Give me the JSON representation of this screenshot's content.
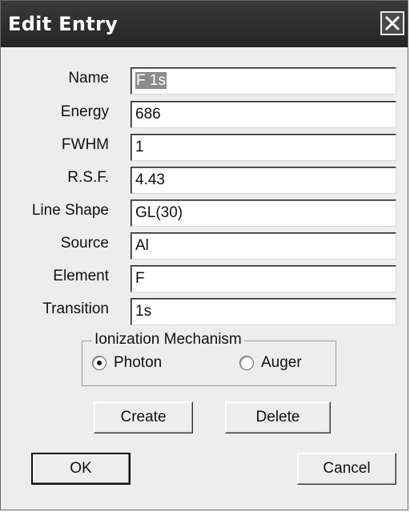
{
  "window": {
    "title": "Edit Entry",
    "close_icon": "close-x-icon"
  },
  "fields": [
    {
      "label": "Name",
      "value": "F 1s",
      "selected": true
    },
    {
      "label": "Energy",
      "value": "686"
    },
    {
      "label": "FWHM",
      "value": "1"
    },
    {
      "label": "R.S.F.",
      "value": "4.43"
    },
    {
      "label": "Line Shape",
      "value": "GL(30)"
    },
    {
      "label": "Source",
      "value": "Al"
    },
    {
      "label": "Element",
      "value": "F"
    },
    {
      "label": "Transition",
      "value": "1s"
    }
  ],
  "ionization": {
    "title": "Ionization Mechanism",
    "options": [
      "Photon",
      "Auger"
    ],
    "selected": "Photon"
  },
  "buttons": {
    "create": "Create",
    "delete": "Delete",
    "ok": "OK",
    "cancel": "Cancel"
  },
  "colors": {
    "titlebar": "#2b2b2b",
    "dialog_bg": "#ededed",
    "selection": "#8c8c8c"
  }
}
